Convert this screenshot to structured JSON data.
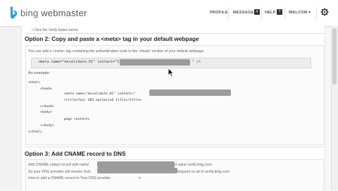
{
  "header": {
    "brand_bing": "bing",
    "brand_rest": " webmaster",
    "nav": {
      "profile": "PROFILE",
      "messages": "MESSAGES",
      "messages_count": "4",
      "help": "HELP",
      "help_glyph": "?",
      "welcome": "WALCOM ▾"
    },
    "icons": [
      "bing-logo-icon",
      "gear-icon"
    ]
  },
  "prev_step": "•   Click the Verify button below",
  "option2": {
    "title": "Option 2: Copy and paste a <meta> tag in your default webpage",
    "description": "You can add a <meta> tag containing the authentication code to the <head> section of your default webpage.",
    "meta_tag_prefix": "<meta name=\"msvalidate.01\" content=\"C3",
    "meta_tag_suffix": "\" />",
    "example_label": "An example:",
    "code_lines": [
      "<html>",
      "      <head>",
      "                  <meta name=\"msvalidate.01\" content=\"",
      "                  <title>Your SEO optimized title</title>",
      "      </head>",
      "      <body>",
      "                  page contents",
      "      </body>",
      "</html>"
    ],
    "code_meta_end": "\" />"
  },
  "option3": {
    "title": "Option 3: Add CNAME record to DNS",
    "line1_a": "Add CNAME (alias) record with name",
    "line1_b": "and value verify.bing.com.",
    "line2_a": "So your DNS provider will resolve host",
    "line2_b": "blogspot.co.uk to verify.bing.com",
    "line3_a": "How to add a CNAME record to",
    "line3_b": "Your DNS provider",
    "line3_c": "▾"
  }
}
